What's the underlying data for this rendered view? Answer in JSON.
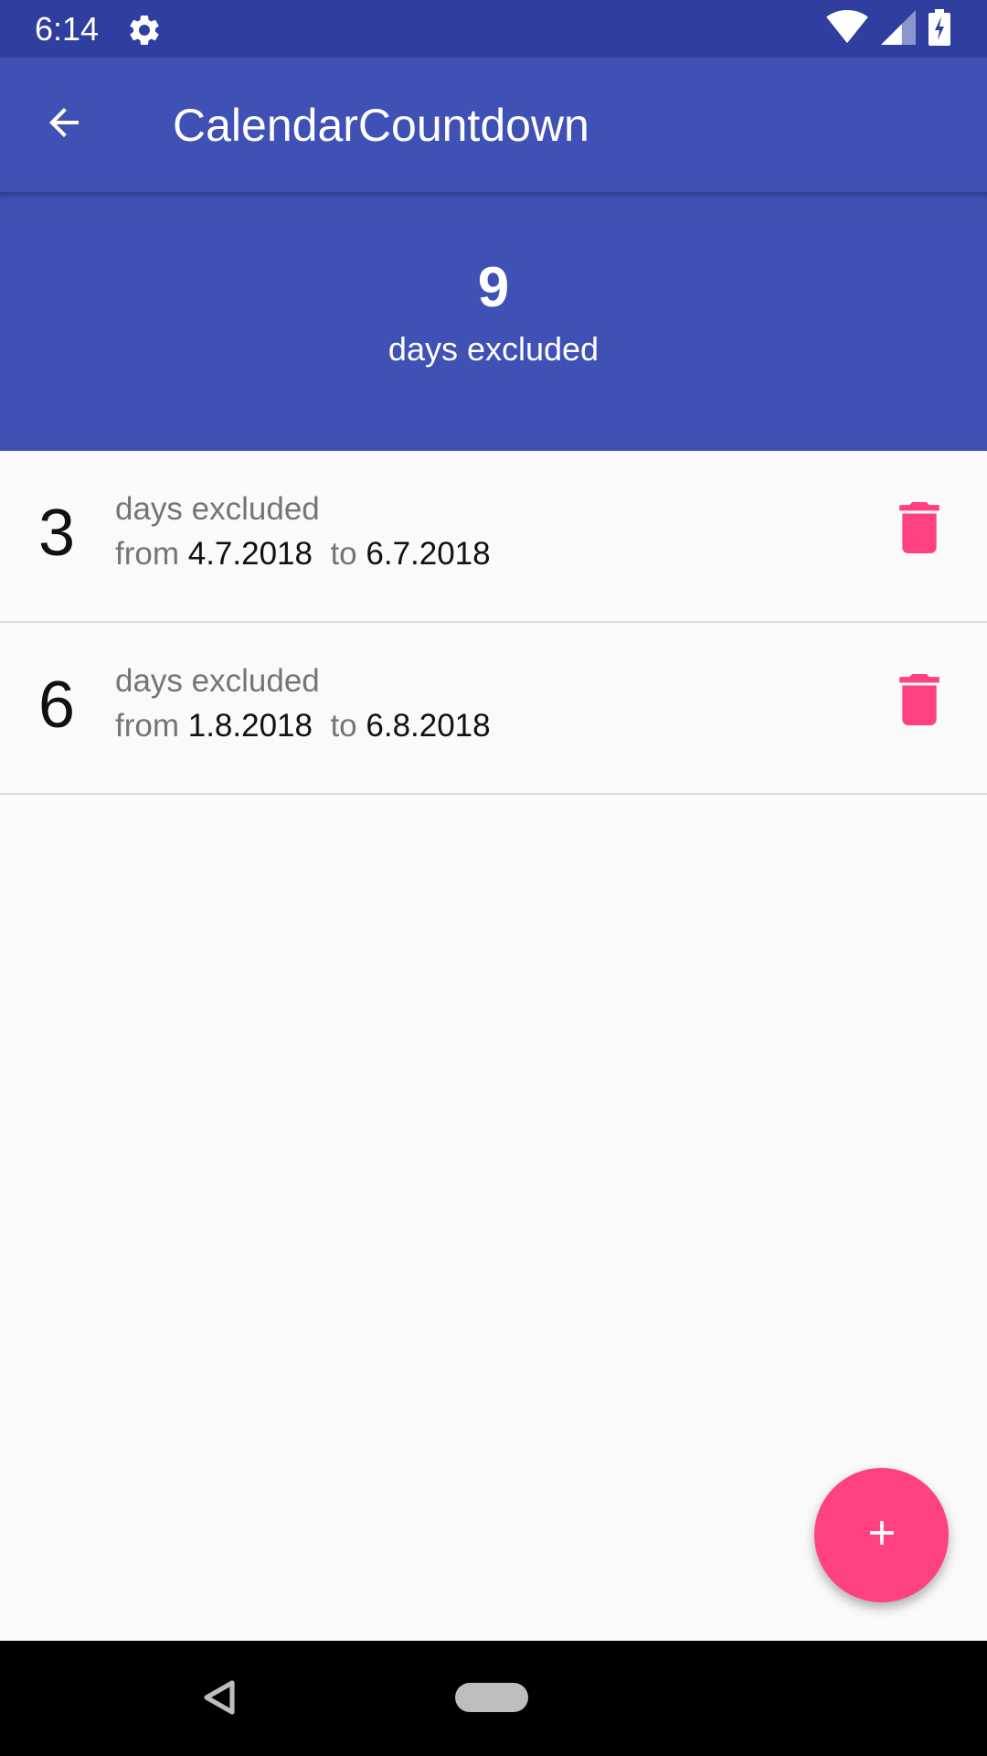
{
  "status_bar": {
    "time": "6:14",
    "icons": [
      "settings-icon",
      "wifi-icon",
      "cell-signal-icon",
      "battery-charging-icon"
    ]
  },
  "app_bar": {
    "title": "CalendarCountdown",
    "back_icon": "arrow-back-icon"
  },
  "summary": {
    "count": "9",
    "label": "days excluded"
  },
  "exclusions": [
    {
      "count": "3",
      "label": "days excluded",
      "from_label": "from",
      "from_date": "4.7.2018",
      "to_label": "to",
      "to_date": "6.7.2018"
    },
    {
      "count": "6",
      "label": "days excluded",
      "from_label": "from",
      "from_date": "1.8.2018",
      "to_label": "to",
      "to_date": "6.8.2018"
    }
  ],
  "fab": {
    "icon": "plus-icon"
  },
  "colors": {
    "status_bar": "#303f9f",
    "primary": "#3f51b5",
    "accent": "#ff4081",
    "background": "#fafafa"
  }
}
